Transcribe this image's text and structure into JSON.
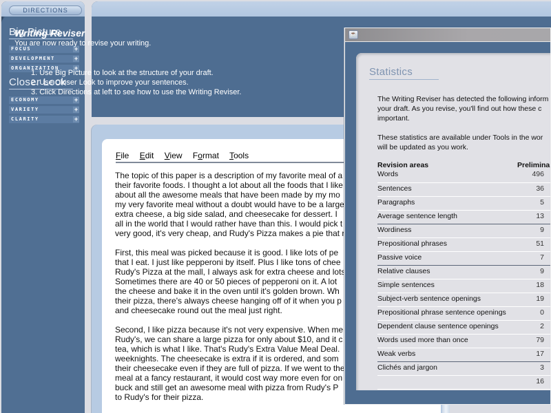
{
  "sidebar": {
    "directions_label": "DIRECTIONS",
    "big_picture": {
      "title": "Big Picture",
      "items": [
        {
          "label": "Focus",
          "icon": "plus-icon"
        },
        {
          "label": "Development",
          "icon": "plus-icon"
        },
        {
          "label": "Organization",
          "icon": "plus-icon"
        }
      ]
    },
    "closer_look": {
      "title": "Closer Look",
      "items": [
        {
          "label": "Economy",
          "icon": "plus-icon"
        },
        {
          "label": "Variety",
          "icon": "plus-icon"
        },
        {
          "label": "Clarity",
          "icon": "plus-icon"
        }
      ]
    }
  },
  "header": {
    "title": "Writing Reviser",
    "subtitle": "You are now ready to revise your writing.",
    "steps": [
      "1.  Use Big Picture to look at the structure of your draft.",
      "2.  Use Closer Look to improve your sentences.",
      "3.  Click Directions at left to see how to use the Writing Reviser."
    ]
  },
  "document": {
    "menu": [
      {
        "label": "File",
        "mnemonic": "F",
        "rest": "ile"
      },
      {
        "label": "Edit",
        "mnemonic": "E",
        "rest": "dit"
      },
      {
        "label": "View",
        "mnemonic": "V",
        "rest": "iew"
      },
      {
        "label": "Format",
        "pre": "F",
        "mnemonic": "o",
        "rest": "rmat"
      },
      {
        "label": "Tools",
        "mnemonic": "T",
        "rest": "ools"
      }
    ],
    "paragraphs": [
      [
        "The topic of this paper is a description of my favorite meal of a",
        "their favorite foods. I thought a lot about all the foods that I like",
        "about all the awesome meals that have been made by my mo",
        "my very favorite meal without a doubt would have to be a large",
        "extra cheese, a big side salad, and cheesecake for dessert. I",
        "all in the world that I would rather have than this. I would pick t",
        "very good, it's very cheap, and Rudy's Pizza makes a pie that r"
      ],
      [
        "First, this meal was picked because it is good. I like lots of pe",
        "that I eat. I just like pepperoni by itself. Plus I like tons of chee",
        "Rudy's Pizza at the mall, I always ask for extra cheese and lots",
        "Sometimes there are 40 or 50 pieces of pepperoni on it. A lot",
        "the cheese and bake it in the oven until it's golden brown. Wh",
        "their pizza, there's always cheese hanging off of it when you p",
        "and cheesecake round out the meal just right."
      ],
      [
        "Second, I like pizza because it's not very expensive. When me",
        "Rudy's, we can share a large pizza for only about $10, and it c",
        "tea, which is what I like. That's Rudy's Extra Value Meal Deal.",
        "weeknights. The cheesecake is extra if it is ordered, and som",
        "their cheesecake even if they are full of pizza. If we went to the",
        "meal at a fancy restaurant, it would cost way more even for on",
        "buck and still get an awesome meal with pizza from Rudy's P",
        "to Rudy's for their pizza."
      ]
    ]
  },
  "statistics": {
    "title": "Statistics",
    "intro": [
      [
        "The Writing Reviser has detected the following inform",
        "your draft. As you revise, you'll find out how these c",
        "important."
      ],
      [
        "These statistics are available under Tools in the wor",
        "will be updated as you work."
      ]
    ],
    "columns": [
      "Revision areas",
      "Prelimina"
    ],
    "rows": [
      {
        "area": "Words",
        "value": "496"
      },
      {
        "area": "Sentences",
        "value": "36"
      },
      {
        "area": "Paragraphs",
        "value": "5"
      },
      {
        "area": "Average sentence length",
        "value": "13",
        "group_end": true
      },
      {
        "area": "Wordiness",
        "value": "9"
      },
      {
        "area": "Prepositional phrases",
        "value": "51"
      },
      {
        "area": "Passive voice",
        "value": "7",
        "group_end": true
      },
      {
        "area": "Relative clauses",
        "value": "9"
      },
      {
        "area": "Simple sentences",
        "value": "18"
      },
      {
        "area": "Subject-verb sentence openings",
        "value": "19"
      },
      {
        "area": "Prepositional phrase sentence openings",
        "value": "0"
      },
      {
        "area": "Dependent clause sentence openings",
        "value": "2"
      },
      {
        "area": "Words used more than once",
        "value": "79"
      },
      {
        "area": "Weak verbs",
        "value": "17",
        "group_end": true
      },
      {
        "area": "Clichés and jargon",
        "value": "3"
      },
      {
        "area": "",
        "value": "16"
      }
    ]
  },
  "colors": {
    "panel_blue": "#4e6d91",
    "panel_light": "#b7cbe3",
    "background": "#dcdde3",
    "stats_bg": "#e1e1e6"
  }
}
